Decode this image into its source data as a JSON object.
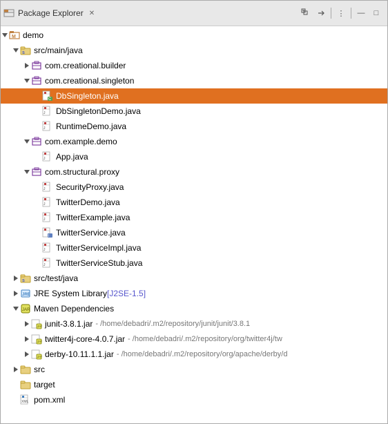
{
  "header": {
    "title": "Package Explorer",
    "close_label": "✕",
    "icon": "package-explorer-icon"
  },
  "toolbar": {
    "buttons": [
      {
        "name": "collapse-all-button",
        "label": "⊟"
      },
      {
        "name": "link-with-editor-button",
        "label": "⇌"
      },
      {
        "name": "view-menu-button",
        "label": "▾"
      },
      {
        "name": "minimize-button",
        "label": "—"
      },
      {
        "name": "maximize-button",
        "label": "□"
      }
    ]
  },
  "tree": {
    "items": [
      {
        "id": "demo",
        "label": "demo",
        "indent": 0,
        "arrow": "▼",
        "icon_type": "project",
        "selected": false
      },
      {
        "id": "src-main-java",
        "label": "src/main/java",
        "indent": 1,
        "arrow": "▼",
        "icon_type": "src-folder",
        "selected": false
      },
      {
        "id": "com-creational-builder",
        "label": "com.creational.builder",
        "indent": 2,
        "arrow": "▶",
        "icon_type": "package",
        "selected": false
      },
      {
        "id": "com-creational-singleton",
        "label": "com.creational.singleton",
        "indent": 2,
        "arrow": "▼",
        "icon_type": "package",
        "selected": false
      },
      {
        "id": "DbSingleton-java",
        "label": "DbSingleton.java",
        "indent": 3,
        "arrow": "",
        "icon_type": "java-class",
        "selected": true
      },
      {
        "id": "DbSingletonDemo-java",
        "label": "DbSingletonDemo.java",
        "indent": 3,
        "arrow": "",
        "icon_type": "java",
        "selected": false
      },
      {
        "id": "RuntimeDemo-java",
        "label": "RuntimeDemo.java",
        "indent": 3,
        "arrow": "",
        "icon_type": "java",
        "selected": false
      },
      {
        "id": "com-example-demo",
        "label": "com.example.demo",
        "indent": 2,
        "arrow": "▼",
        "icon_type": "package",
        "selected": false
      },
      {
        "id": "App-java",
        "label": "App.java",
        "indent": 3,
        "arrow": "",
        "icon_type": "java",
        "selected": false
      },
      {
        "id": "com-structural-proxy",
        "label": "com.structural.proxy",
        "indent": 2,
        "arrow": "▼",
        "icon_type": "package",
        "selected": false
      },
      {
        "id": "SecurityProxy-java",
        "label": "SecurityProxy.java",
        "indent": 3,
        "arrow": "",
        "icon_type": "java",
        "selected": false
      },
      {
        "id": "TwitterDemo-java",
        "label": "TwitterDemo.java",
        "indent": 3,
        "arrow": "",
        "icon_type": "java",
        "selected": false
      },
      {
        "id": "TwitterExample-java",
        "label": "TwitterExample.java",
        "indent": 3,
        "arrow": "",
        "icon_type": "java",
        "selected": false
      },
      {
        "id": "TwitterService-java",
        "label": "TwitterService.java",
        "indent": 3,
        "arrow": "",
        "icon_type": "java-interface",
        "selected": false
      },
      {
        "id": "TwitterServiceImpl-java",
        "label": "TwitterServiceImpl.java",
        "indent": 3,
        "arrow": "",
        "icon_type": "java",
        "selected": false
      },
      {
        "id": "TwitterServiceStub-java",
        "label": "TwitterServiceStub.java",
        "indent": 3,
        "arrow": "",
        "icon_type": "java",
        "selected": false
      },
      {
        "id": "src-test-java",
        "label": "src/test/java",
        "indent": 1,
        "arrow": "▶",
        "icon_type": "src-folder",
        "selected": false
      },
      {
        "id": "jre-system-library",
        "label": "JRE System Library",
        "label_extra": "[J2SE-1.5]",
        "indent": 1,
        "arrow": "▶",
        "icon_type": "jre",
        "selected": false
      },
      {
        "id": "maven-dependencies",
        "label": "Maven Dependencies",
        "indent": 1,
        "arrow": "▼",
        "icon_type": "jar",
        "selected": false
      },
      {
        "id": "junit-jar",
        "label": "junit-3.8.1.jar",
        "label_path": " - /home/debadri/.m2/repository/junit/junit/3.8.1",
        "indent": 2,
        "arrow": "▶",
        "icon_type": "jar-file",
        "selected": false
      },
      {
        "id": "twitter4j-jar",
        "label": "twitter4j-core-4.0.7.jar",
        "label_path": " - /home/debadri/.m2/repository/org/twitter4j/tw",
        "indent": 2,
        "arrow": "▶",
        "icon_type": "jar-file",
        "selected": false
      },
      {
        "id": "derby-jar",
        "label": "derby-10.11.1.1.jar",
        "label_path": " - /home/debadri/.m2/repository/org/apache/derby/d",
        "indent": 2,
        "arrow": "▶",
        "icon_type": "jar-file",
        "selected": false
      },
      {
        "id": "src-folder",
        "label": "src",
        "indent": 1,
        "arrow": "▶",
        "icon_type": "src-folder2",
        "selected": false
      },
      {
        "id": "target-folder",
        "label": "target",
        "indent": 1,
        "arrow": "",
        "icon_type": "folder",
        "selected": false
      },
      {
        "id": "pom-xml",
        "label": "pom.xml",
        "indent": 1,
        "arrow": "",
        "icon_type": "xml",
        "selected": false
      }
    ]
  }
}
